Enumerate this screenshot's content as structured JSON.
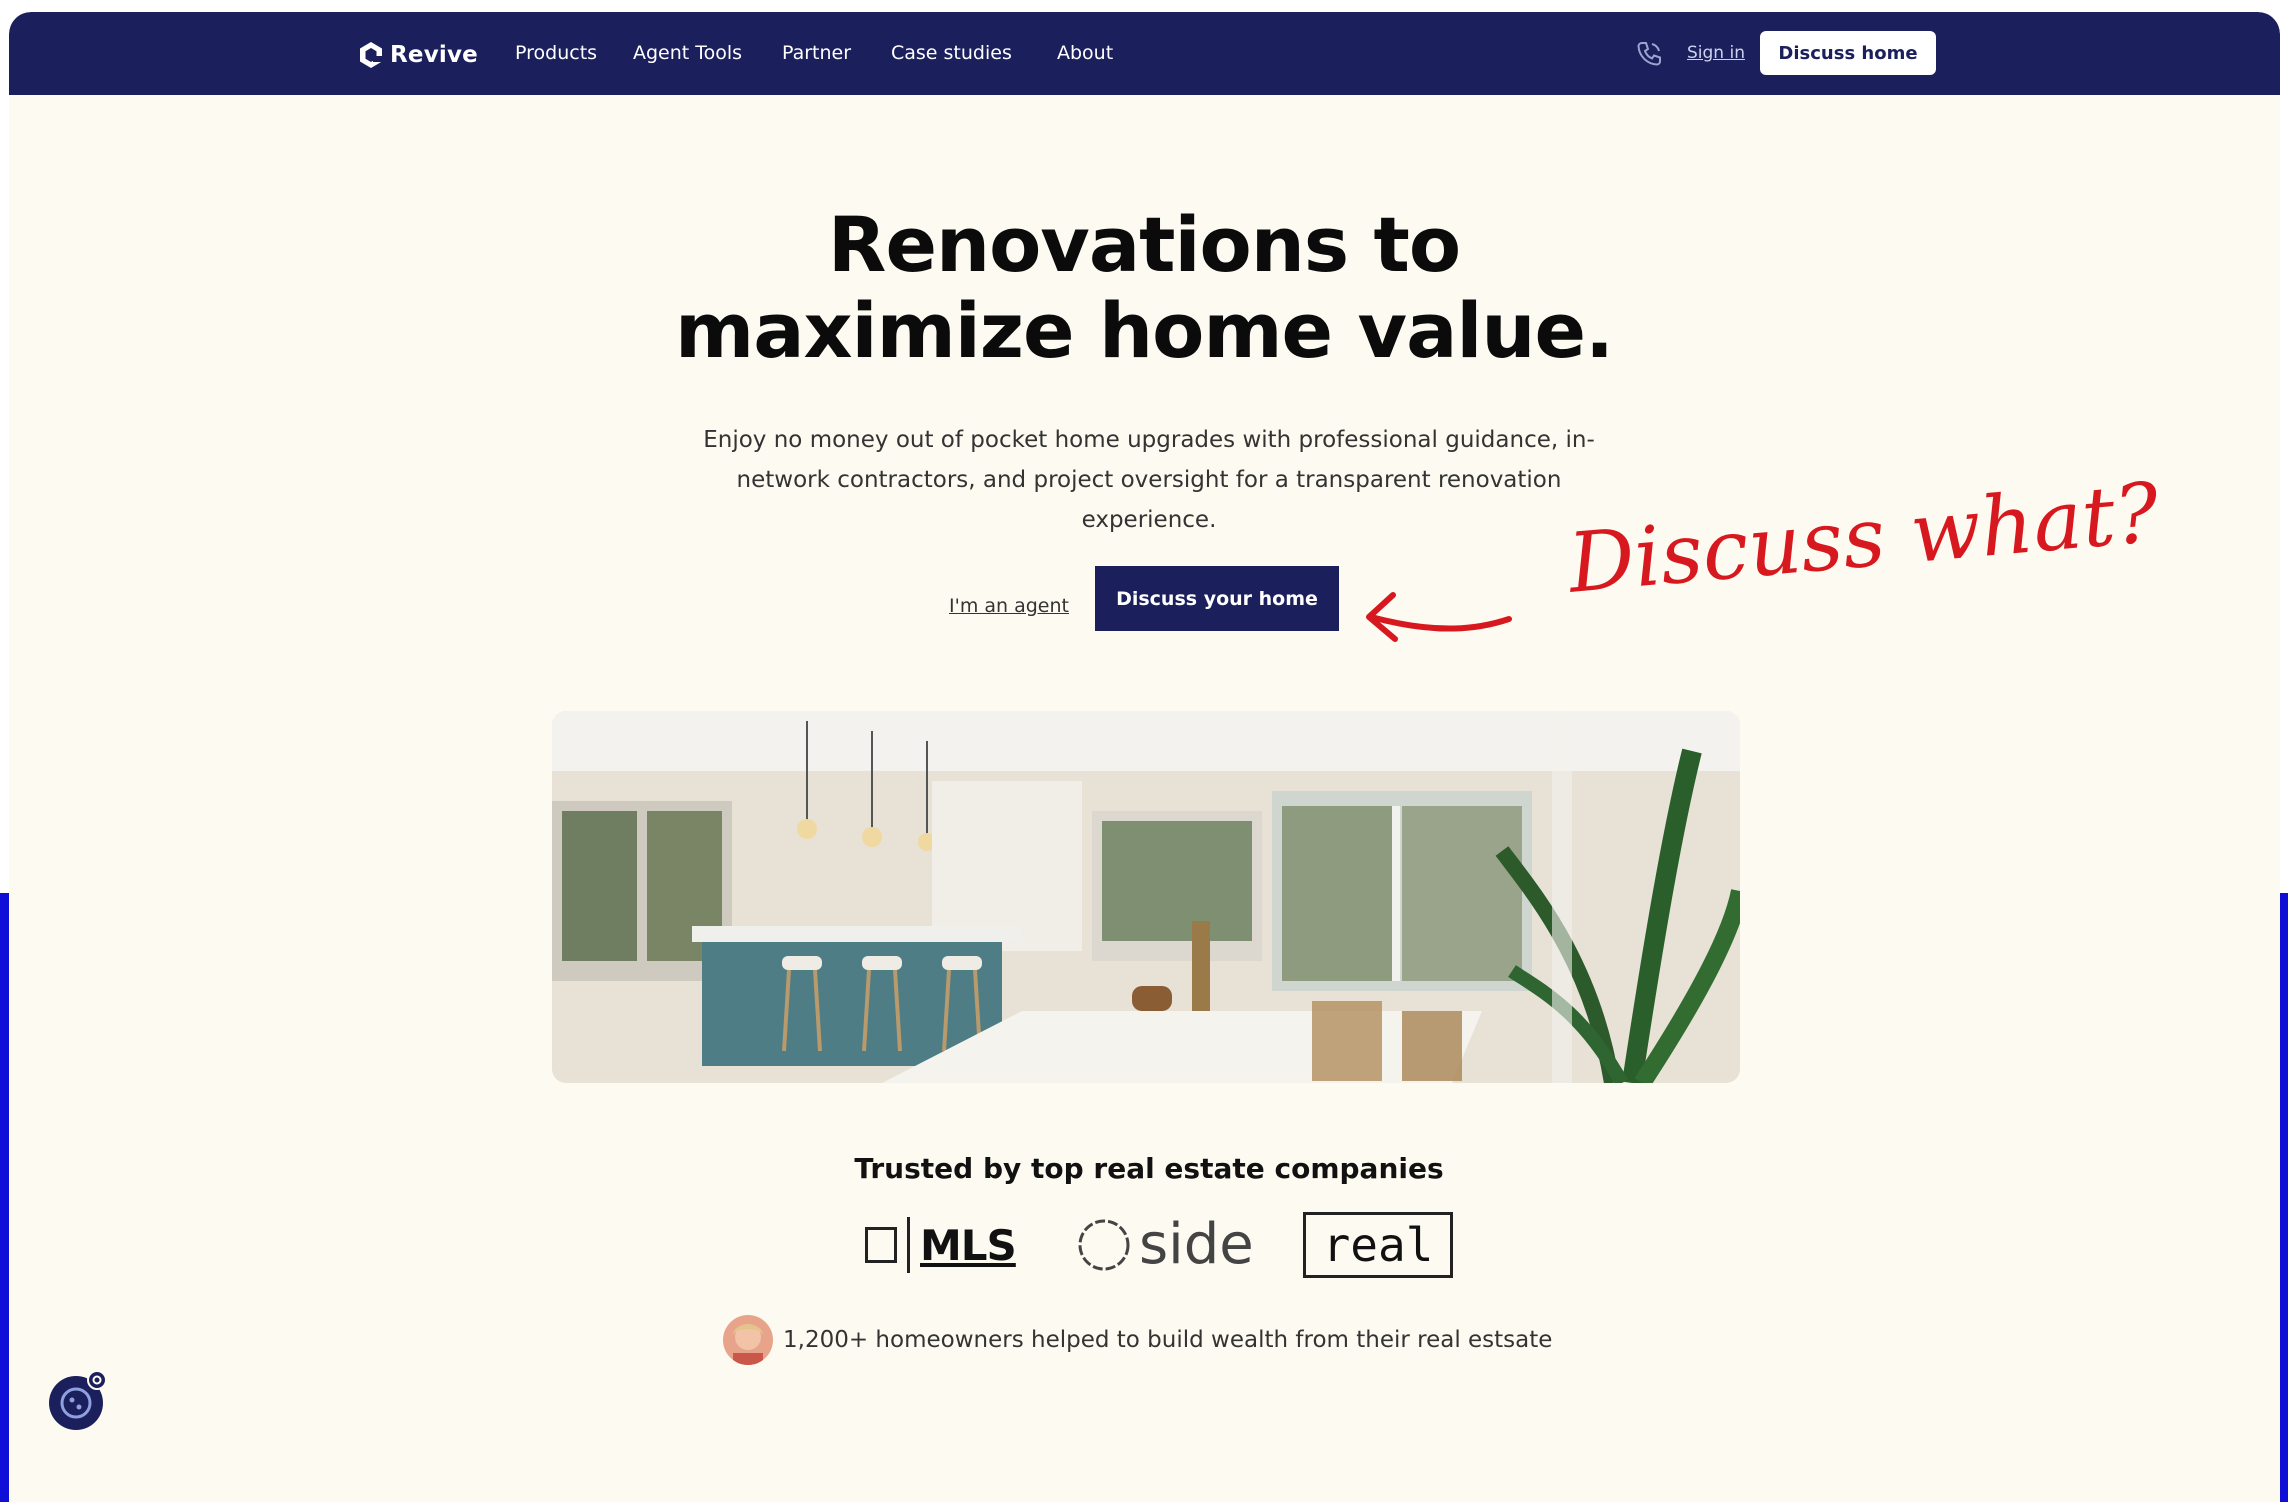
{
  "nav": {
    "brand": "Revive",
    "items": [
      "Products",
      "Agent Tools",
      "Partner",
      "Case studies",
      "About"
    ],
    "phone_icon": "phone-icon",
    "signin": "Sign in",
    "cta": "Discuss home"
  },
  "hero": {
    "title_line1": "Renovations to",
    "title_line2": "maximize home value.",
    "subtitle": "Enjoy no money out of pocket home upgrades with professional guidance, in-network contractors, and project oversight for a transparent renovation experience.",
    "agent_link": "I'm an agent",
    "cta": "Discuss your home"
  },
  "annotation": {
    "text": "Discuss what?",
    "color": "#d7191f"
  },
  "trust": {
    "heading": "Trusted by top real estate companies",
    "logos": [
      "MLS",
      "side",
      "real"
    ]
  },
  "social_proof": {
    "text": "1,200+ homeowners helped to build wealth from their real estsate"
  },
  "colors": {
    "navy": "#1b1f5b",
    "cream": "#fdfbf1",
    "outer_blue": "#0f0fd8",
    "annotation_red": "#d7191f"
  }
}
